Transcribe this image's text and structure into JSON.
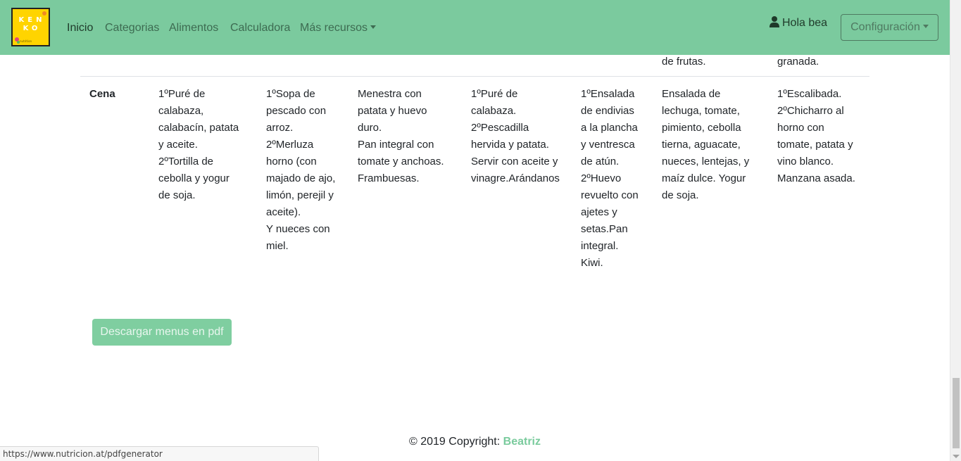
{
  "navbar": {
    "logo": {
      "text": "KEN KO",
      "subtext": "nutrition"
    },
    "links": [
      "Inicio",
      "Categorias",
      "Alimentos",
      "Calculadora",
      "Más recursos"
    ],
    "active": "Inicio",
    "user_greeting": "Hola bea",
    "settings_label": "Configuración",
    "background_color": "#7bca9e"
  },
  "table": {
    "previous_row_tail": [
      "de frutas.",
      "granada."
    ],
    "cena": {
      "label": "Cena",
      "cells": [
        "1ºPuré de\ncalabaza,\ncalabacín, patata\ny aceite.\n2ºTortilla de\ncebolla y yogur\nde soja.",
        "1ºSopa de\npescado con\narroz.\n2ºMerluza\nhorno (con\nmajado de ajo,\nlimón, perejil y\naceite).\nY nueces con\nmiel.",
        "Menestra con\npatata y huevo\nduro.\nPan integral con\ntomate y anchoas.\nFrambuesas.",
        "1ºPuré de\ncalabaza.\n2ºPescadilla\nhervida y patata.\nServir con aceite y\nvinagre.Arándanos",
        "1ºEnsalada\nde endivias\na la plancha\ny ventresca\nde atún.\n2ºHuevo\nrevuelto con\najetes y\nsetas.Pan\nintegral.\nKiwi.",
        "Ensalada de\nlechuga, tomate,\npimiento, cebolla\ntierna, aguacate,\nnueces, lentejas, y\nmaíz dulce. Yogur\nde soja.",
        "1ºEscalibada.\n2ºChicharro al\nhorno con\ntomate, patata y\nvino blanco.\nManzana asada."
      ]
    }
  },
  "pdf_button_label": "Descargar menus en pdf",
  "footer": {
    "copyright": "© 2019 Copyright: ",
    "author": "Beatriz",
    "accent_color": "#7acb9d"
  },
  "status_bar": {
    "url": "https://www.nutricion.at/pdfgenerator"
  }
}
